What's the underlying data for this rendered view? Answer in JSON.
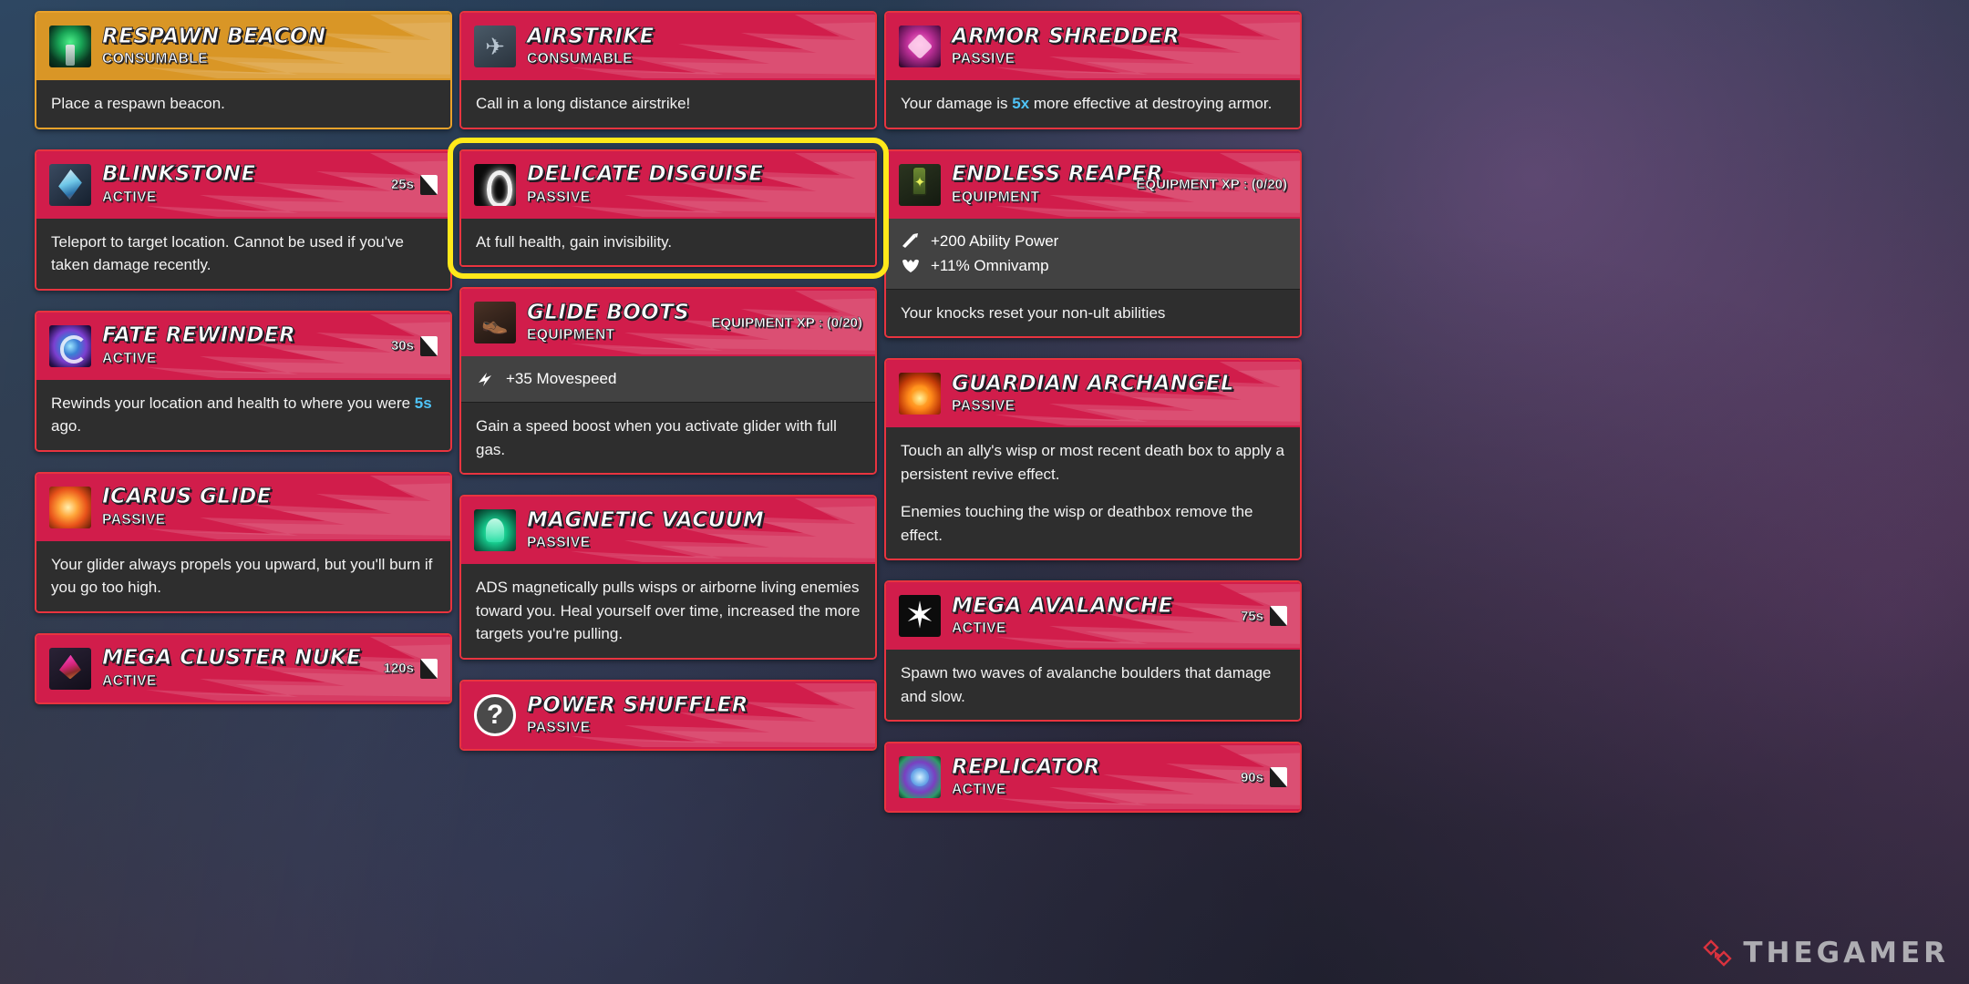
{
  "watermark": {
    "text": "THEGAMER",
    "logo_icon": "diamond-logo-icon"
  },
  "columns": [
    {
      "cards": [
        {
          "name": "RESPAWN BEACON",
          "type": "CONSUMABLE",
          "rarity_color": "#e9a22b",
          "header_color": "#d99626",
          "thumb_icon": "respawn-beacon-icon",
          "thumb_class": "tb-beacon",
          "cooldown": "",
          "xp_label": "",
          "selected": false,
          "stats": [],
          "body": [
            {
              "text": "Place a respawn beacon."
            }
          ],
          "extra_body": ""
        },
        {
          "name": "BLINKSTONE",
          "type": "ACTIVE",
          "rarity_color": "#e8343f",
          "header_color": "#d11d4b",
          "thumb_icon": "blinkstone-icon",
          "thumb_class": "tb-blink",
          "cooldown": "25s",
          "xp_label": "",
          "selected": false,
          "stats": [],
          "body": [
            {
              "text": "Teleport to target location. Cannot be used if you've taken damage recently."
            }
          ],
          "extra_body": ""
        },
        {
          "name": "FATE REWINDER",
          "type": "ACTIVE",
          "rarity_color": "#e8343f",
          "header_color": "#d11d4b",
          "thumb_icon": "fate-rewinder-icon",
          "thumb_class": "tb-fate",
          "cooldown": "30s",
          "xp_label": "",
          "selected": false,
          "stats": [],
          "body": [
            {
              "pre": "Rewinds your location and health to where you were ",
              "hl": "5s",
              "post": " ago."
            }
          ],
          "extra_body": ""
        },
        {
          "name": "ICARUS GLIDE",
          "type": "PASSIVE",
          "rarity_color": "#e8343f",
          "header_color": "#d11d4b",
          "thumb_icon": "icarus-glide-icon",
          "thumb_class": "tb-icarus",
          "cooldown": "",
          "xp_label": "",
          "selected": false,
          "stats": [],
          "body": [
            {
              "text": "Your glider always propels you upward, but you'll burn if you go too high."
            }
          ],
          "extra_body": ""
        },
        {
          "name": "MEGA CLUSTER NUKE",
          "type": "ACTIVE",
          "rarity_color": "#e8343f",
          "header_color": "#d11d4b",
          "thumb_icon": "mega-cluster-nuke-icon",
          "thumb_class": "tb-nuke",
          "cooldown": "120s",
          "xp_label": "",
          "selected": false,
          "stats": [],
          "body": [],
          "extra_body": ""
        }
      ]
    },
    {
      "cards": [
        {
          "name": "AIRSTRIKE",
          "type": "CONSUMABLE",
          "rarity_color": "#e8343f",
          "header_color": "#d11d4b",
          "thumb_icon": "airstrike-icon",
          "thumb_class": "tb-air",
          "cooldown": "",
          "xp_label": "",
          "selected": false,
          "stats": [],
          "body": [
            {
              "text": "Call in a long distance airstrike!"
            }
          ],
          "extra_body": ""
        },
        {
          "name": "DELICATE DISGUISE",
          "type": "PASSIVE",
          "rarity_color": "#e8343f",
          "header_color": "#d11d4b",
          "thumb_icon": "delicate-disguise-icon",
          "thumb_class": "tb-disguise",
          "cooldown": "",
          "xp_label": "",
          "selected": true,
          "stats": [],
          "body": [
            {
              "text": "At full health, gain invisibility."
            }
          ],
          "extra_body": ""
        },
        {
          "name": "GLIDE BOOTS",
          "type": "EQUIPMENT",
          "rarity_color": "#e8343f",
          "header_color": "#d11d4b",
          "thumb_icon": "glide-boots-icon",
          "thumb_class": "tb-glide",
          "cooldown": "",
          "xp_label": "EQUIPMENT XP : (0/20)",
          "selected": false,
          "stats": [
            {
              "icon": "movespeed-icon",
              "text": "+35 Movespeed"
            }
          ],
          "body": [],
          "extra_body": "Gain a speed boost when you activate glider with full gas."
        },
        {
          "name": "MAGNETIC VACUUM",
          "type": "PASSIVE",
          "rarity_color": "#e8343f",
          "header_color": "#d11d4b",
          "thumb_icon": "magnetic-vacuum-icon",
          "thumb_class": "tb-magnetic",
          "cooldown": "",
          "xp_label": "",
          "selected": false,
          "stats": [],
          "body": [
            {
              "text": "ADS magnetically pulls wisps or airborne living enemies toward you. Heal yourself over time, increased the more targets you're pulling."
            }
          ],
          "extra_body": ""
        },
        {
          "name": "POWER SHUFFLER",
          "type": "PASSIVE",
          "rarity_color": "#e8343f",
          "header_color": "#d11d4b",
          "thumb_icon": "power-shuffler-icon",
          "thumb_class": "tb-shuffle",
          "cooldown": "",
          "xp_label": "",
          "selected": false,
          "stats": [],
          "body": [],
          "extra_body": ""
        }
      ]
    },
    {
      "cards": [
        {
          "name": "ARMOR SHREDDER",
          "type": "PASSIVE",
          "rarity_color": "#e8343f",
          "header_color": "#d11d4b",
          "thumb_icon": "armor-shredder-icon",
          "thumb_class": "tb-armor",
          "cooldown": "",
          "xp_label": "",
          "selected": false,
          "stats": [],
          "body": [
            {
              "pre": "Your damage is ",
              "hl": "5x",
              "post": " more effective at destroying armor."
            }
          ],
          "extra_body": ""
        },
        {
          "name": "ENDLESS REAPER",
          "type": "EQUIPMENT",
          "rarity_color": "#e8343f",
          "header_color": "#d11d4b",
          "thumb_icon": "endless-reaper-icon",
          "thumb_class": "tb-reaper",
          "cooldown": "",
          "xp_label": "EQUIPMENT XP : (0/20)",
          "selected": false,
          "stats": [
            {
              "icon": "ability-power-icon",
              "text": "+200 Ability Power"
            },
            {
              "icon": "omnivamp-icon",
              "text": "+11% Omnivamp"
            }
          ],
          "body": [],
          "extra_body": "Your knocks reset your non-ult abilities"
        },
        {
          "name": "GUARDIAN ARCHANGEL",
          "type": "PASSIVE",
          "rarity_color": "#e8343f",
          "header_color": "#d11d4b",
          "thumb_icon": "guardian-archangel-icon",
          "thumb_class": "tb-guardian",
          "cooldown": "",
          "xp_label": "",
          "selected": false,
          "stats": [],
          "body": [
            {
              "text": "Touch an ally's wisp or most recent death box to apply a persistent revive effect."
            },
            {
              "text": "Enemies touching the wisp or deathbox remove the effect."
            }
          ],
          "extra_body": ""
        },
        {
          "name": "MEGA AVALANCHE",
          "type": "ACTIVE",
          "rarity_color": "#e8343f",
          "header_color": "#d11d4b",
          "thumb_icon": "mega-avalanche-icon",
          "thumb_class": "tb-avalanche",
          "cooldown": "75s",
          "xp_label": "",
          "selected": false,
          "stats": [],
          "body": [
            {
              "text": "Spawn two waves of avalanche boulders that damage and slow."
            }
          ],
          "extra_body": ""
        },
        {
          "name": "REPLICATOR",
          "type": "ACTIVE",
          "rarity_color": "#e8343f",
          "header_color": "#d11d4b",
          "thumb_icon": "replicator-icon",
          "thumb_class": "tb-replicator",
          "cooldown": "90s",
          "xp_label": "",
          "selected": false,
          "stats": [],
          "body": [],
          "extra_body": ""
        }
      ]
    }
  ]
}
